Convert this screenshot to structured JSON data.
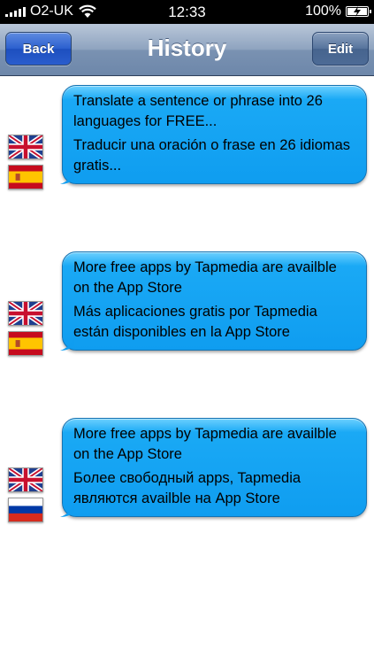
{
  "status_bar": {
    "carrier": "O2-UK",
    "time": "12:33",
    "battery": "100%",
    "signal_bars": 5
  },
  "nav": {
    "back_label": "Back",
    "title": "History",
    "edit_label": "Edit"
  },
  "entries": [
    {
      "source_flag": "uk-flag",
      "target_flag": "spain-flag",
      "source_text": "Translate a sentence or phrase into 26 languages for FREE...",
      "translated_text": "Traducir una oración o frase en 26 idiomas gratis..."
    },
    {
      "source_flag": "uk-flag",
      "target_flag": "spain-flag",
      "source_text": "More free apps by Tapmedia are availble on the App Store",
      "translated_text": "Más aplicaciones gratis por Tapmedia están disponibles en la App Store"
    },
    {
      "source_flag": "uk-flag",
      "target_flag": "russia-flag",
      "source_text": "More free apps by Tapmedia are availble on the App Store",
      "translated_text": "Более свободный apps, Tapmedia являются availble на App Store"
    }
  ],
  "colors": {
    "bubble": "#1aa9f5",
    "nav_bar": "#7a92b2",
    "back_button": "#2b5fcf"
  }
}
